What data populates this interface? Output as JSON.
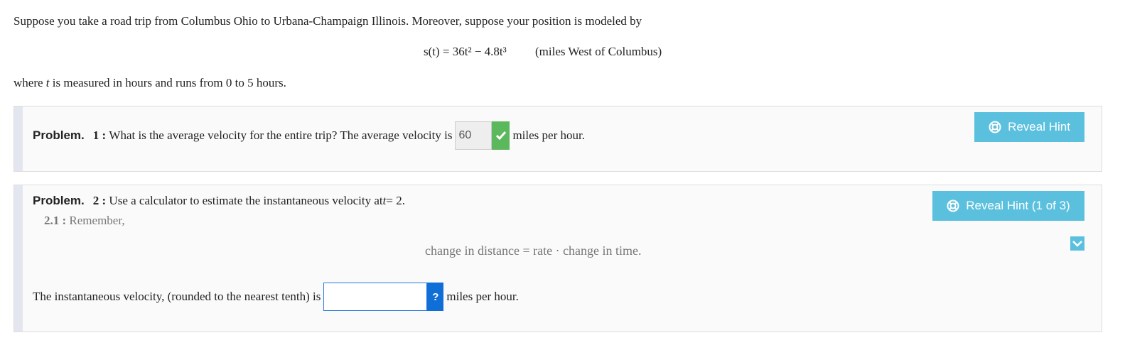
{
  "intro": {
    "text": "Suppose you take a road trip from Columbus Ohio to Urbana-Champaign Illinois. Moreover, suppose your position is modeled by"
  },
  "equation": {
    "lhs": "s(t) = 36t² − 4.8t³",
    "units": "(miles West of Columbus)"
  },
  "where": {
    "prefix": "where ",
    "var": "t",
    "suffix": " is measured in hours and runs from 0 to 5 hours."
  },
  "problem1": {
    "label": "Problem.",
    "number": "1 :",
    "question": "What is the average velocity for the entire trip? The average velocity is",
    "answer_value": "60",
    "answer_status": "correct",
    "unit_text": "miles per hour.",
    "hint_button": "Reveal Hint"
  },
  "problem2": {
    "label": "Problem.",
    "number": "2 :",
    "question_prefix": "Use a calculator to estimate the instantaneous velocity at ",
    "question_var": "t",
    "question_suffix": " = 2.",
    "hint_button": "Reveal Hint (1 of 3)",
    "subhint": {
      "number": "2.1 :",
      "text": "Remember,"
    },
    "hint_formula": "change in distance = rate · change in time.",
    "answer_prompt": "The instantaneous velocity, (rounded to the nearest tenth) is",
    "answer_value": "",
    "help_label": "?",
    "unit_text": "miles per hour."
  },
  "colors": {
    "hint_button": "#5bc0de",
    "correct_check": "#5cb85c",
    "help_button": "#0f6fd6",
    "panel_bg": "#fafafa",
    "panel_stripe": "#e4e6ef"
  },
  "icons": [
    "lifebuoy-icon",
    "check-icon",
    "chevron-down-icon",
    "question-icon"
  ]
}
